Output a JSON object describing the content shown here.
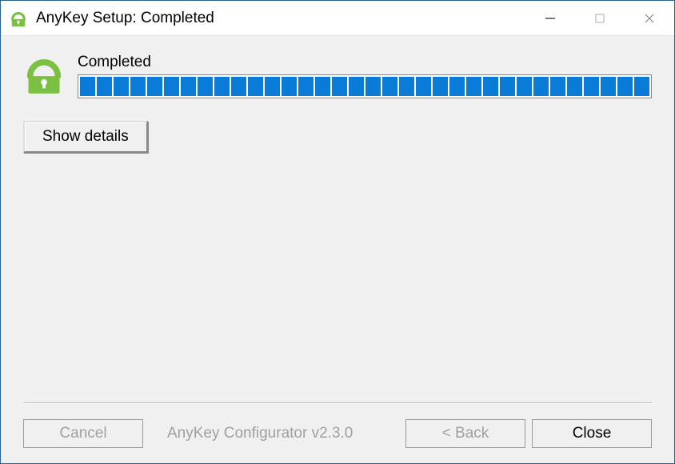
{
  "titlebar": {
    "title": "AnyKey Setup: Completed"
  },
  "main": {
    "status_label": "Completed",
    "show_details_label": "Show details",
    "progress_segments": 34
  },
  "footer": {
    "cancel_label": "Cancel",
    "branding": "AnyKey Configurator v2.3.0",
    "back_label": "< Back",
    "close_label": "Close"
  }
}
